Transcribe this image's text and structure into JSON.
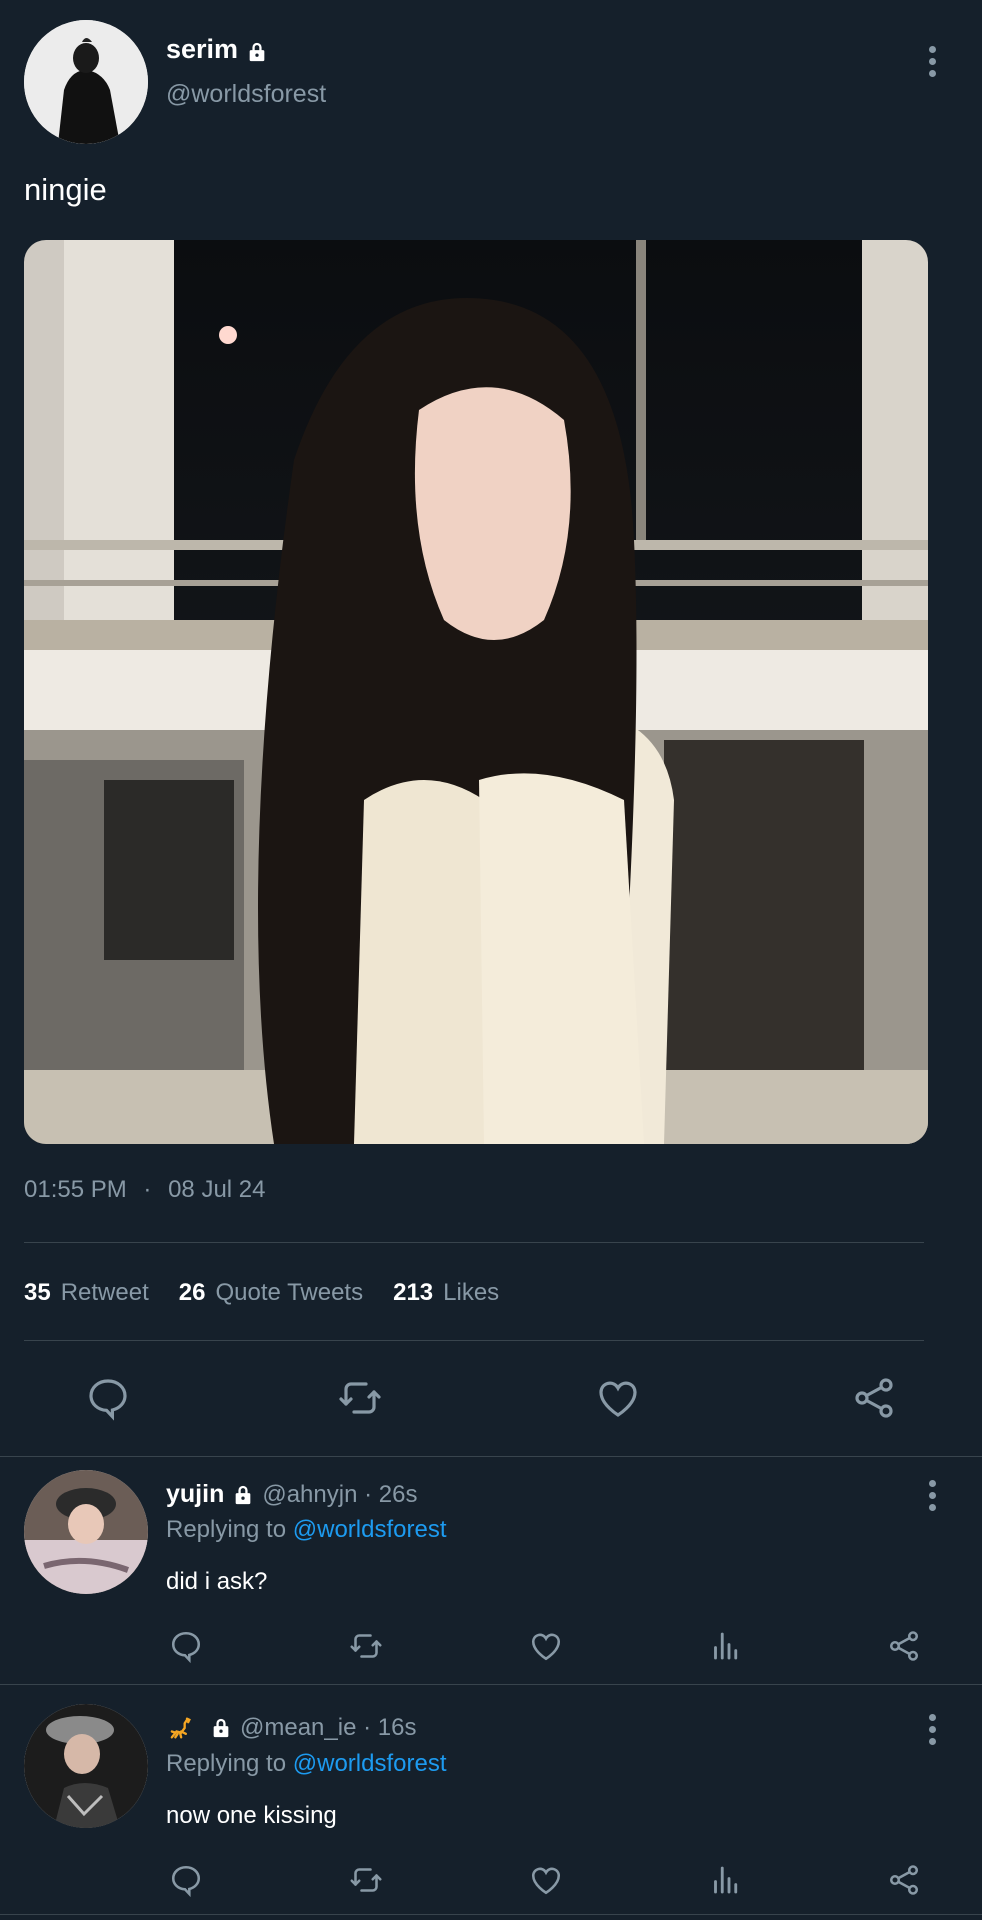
{
  "tweet": {
    "author": {
      "name": "serim",
      "handle": "@worldsforest",
      "protected": true
    },
    "text": "ningie",
    "time": "01:55 PM",
    "date": "08 Jul 24",
    "separator": "·",
    "stats": [
      {
        "count": "35",
        "label": "Retweet"
      },
      {
        "count": "26",
        "label": "Quote Tweets"
      },
      {
        "count": "213",
        "label": "Likes"
      }
    ],
    "actions": [
      "reply-icon",
      "retweet-icon",
      "like-icon",
      "share-icon"
    ]
  },
  "replies": [
    {
      "name": "yujin",
      "protected": true,
      "handle": "@ahnyjn · 26s",
      "replying_prefix": "Replying to ",
      "replying_to": "@worldsforest",
      "text": "did i ask?"
    },
    {
      "name": "",
      "emoji": "scorpion",
      "protected": true,
      "handle": "@mean_ie · 16s",
      "replying_prefix": "Replying to ",
      "replying_to": "@worldsforest",
      "text": "now one kissing"
    }
  ],
  "colors": {
    "background": "#15202b",
    "muted": "#8899a6",
    "link": "#1d9bf0",
    "divider": "#38444d"
  }
}
